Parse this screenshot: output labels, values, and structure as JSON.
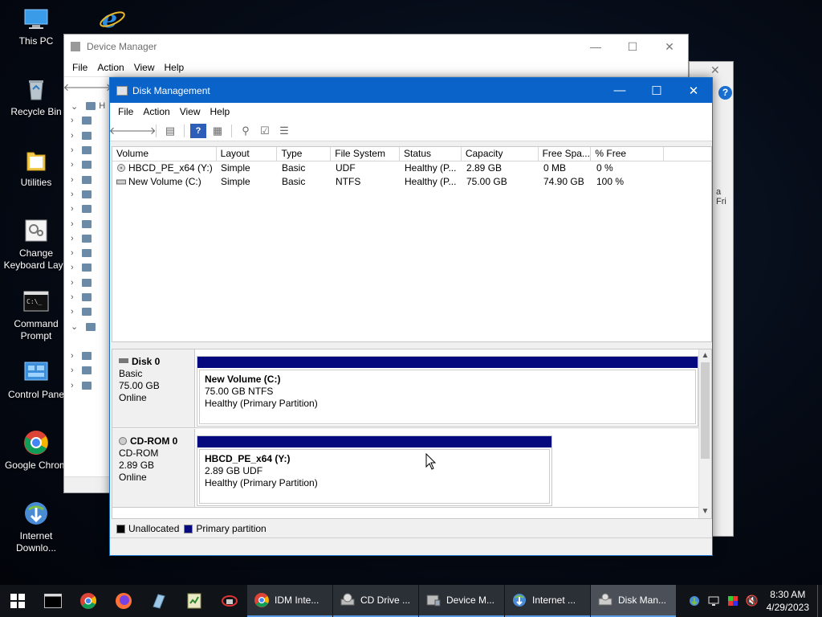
{
  "desktop": {
    "icons": [
      {
        "label": "This PC",
        "icon": "this-pc-icon"
      },
      {
        "label": "Recycle Bin",
        "icon": "recycle-bin-icon"
      },
      {
        "label": "Utilities",
        "icon": "folder-icon"
      },
      {
        "label": "Change Keyboard Layo",
        "icon": "keyboard-layout-icon"
      },
      {
        "label": "Command Prompt",
        "icon": "command-prompt-icon"
      },
      {
        "label": "Control Pane",
        "icon": "control-panel-icon"
      },
      {
        "label": "Google Chrom",
        "icon": "chrome-icon"
      },
      {
        "label": "Internet Downlo...",
        "icon": "internet-download-manager-icon"
      }
    ]
  },
  "device_manager": {
    "title": "Device Manager",
    "menu": [
      "File",
      "Action",
      "View",
      "Help"
    ],
    "tree_root_fragment": "H"
  },
  "back_window": {
    "fragment": "a Fri"
  },
  "disk_management": {
    "title": "Disk Management",
    "menu": [
      "File",
      "Action",
      "View",
      "Help"
    ],
    "columns": [
      "Volume",
      "Layout",
      "Type",
      "File System",
      "Status",
      "Capacity",
      "Free Spa...",
      "% Free"
    ],
    "volumes": [
      {
        "volume": "HBCD_PE_x64 (Y:)",
        "layout": "Simple",
        "type": "Basic",
        "fs": "UDF",
        "status": "Healthy (P...",
        "capacity": "2.89 GB",
        "free": "0 MB",
        "pct": "0 %"
      },
      {
        "volume": "New Volume (C:)",
        "layout": "Simple",
        "type": "Basic",
        "fs": "NTFS",
        "status": "Healthy (P...",
        "capacity": "75.00 GB",
        "free": "74.90 GB",
        "pct": "100 %"
      }
    ],
    "disks": [
      {
        "name": "Disk 0",
        "kind": "Basic",
        "size": "75.00 GB",
        "state": "Online",
        "partition": {
          "name": "New Volume  (C:)",
          "size_fs": "75.00 GB NTFS",
          "status": "Healthy (Primary Partition)"
        }
      },
      {
        "name": "CD-ROM 0",
        "kind": "CD-ROM",
        "size": "2.89 GB",
        "state": "Online",
        "partition": {
          "name": "HBCD_PE_x64  (Y:)",
          "size_fs": "2.89 GB UDF",
          "status": "Healthy (Primary Partition)"
        }
      }
    ],
    "legend": [
      {
        "label": "Unallocated",
        "color": "#000000"
      },
      {
        "label": "Primary partition",
        "color": "#06097e"
      }
    ]
  },
  "taskbar": {
    "apps": [
      {
        "label": "IDM Inte...",
        "icon": "chrome-icon"
      },
      {
        "label": "CD Drive ...",
        "icon": "cd-drive-icon"
      },
      {
        "label": "Device M...",
        "icon": "device-manager-icon"
      },
      {
        "label": "Internet ...",
        "icon": "internet-download-manager-icon"
      },
      {
        "label": "Disk Man...",
        "icon": "disk-management-icon"
      }
    ],
    "clock": {
      "time": "8:30 AM",
      "date": "4/29/2023"
    }
  },
  "colors": {
    "titlebar": "#0a63c9",
    "primary_partition": "#06097e",
    "taskbar": "#101418"
  }
}
